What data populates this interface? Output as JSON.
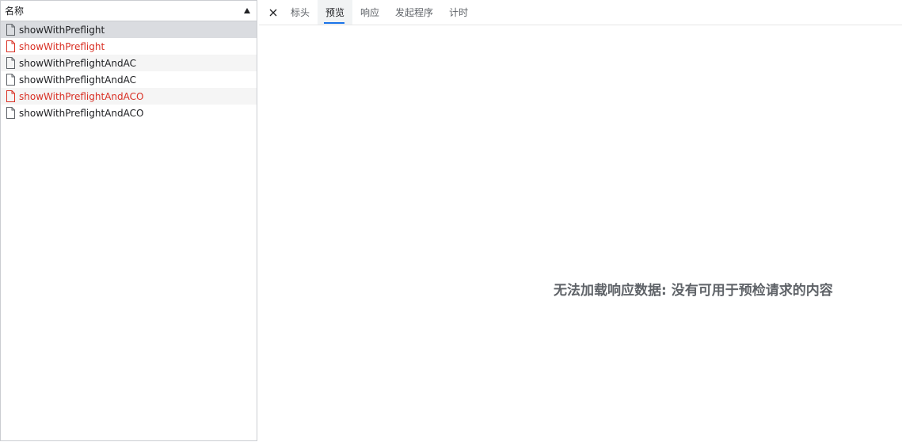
{
  "list": {
    "header": {
      "name_label": "名称"
    },
    "rows": [
      {
        "label": "showWithPreflight",
        "state": "selected"
      },
      {
        "label": "showWithPreflight",
        "state": "error"
      },
      {
        "label": "showWithPreflightAndAC",
        "state": "normal"
      },
      {
        "label": "showWithPreflightAndAC",
        "state": "normal"
      },
      {
        "label": "showWithPreflightAndACO",
        "state": "error"
      },
      {
        "label": "showWithPreflightAndACO",
        "state": "normal"
      }
    ]
  },
  "detail": {
    "close_icon": "close-icon",
    "tabs": [
      {
        "label": "标头",
        "active": false
      },
      {
        "label": "预览",
        "active": true
      },
      {
        "label": "响应",
        "active": false
      },
      {
        "label": "发起程序",
        "active": false
      },
      {
        "label": "计时",
        "active": false
      }
    ],
    "preview_message": "无法加载响应数据: 没有可用于预检请求的内容"
  },
  "colors": {
    "error": "#d93025",
    "selected_row": "#dadce0",
    "active_tab_underline": "#1a73e8"
  }
}
